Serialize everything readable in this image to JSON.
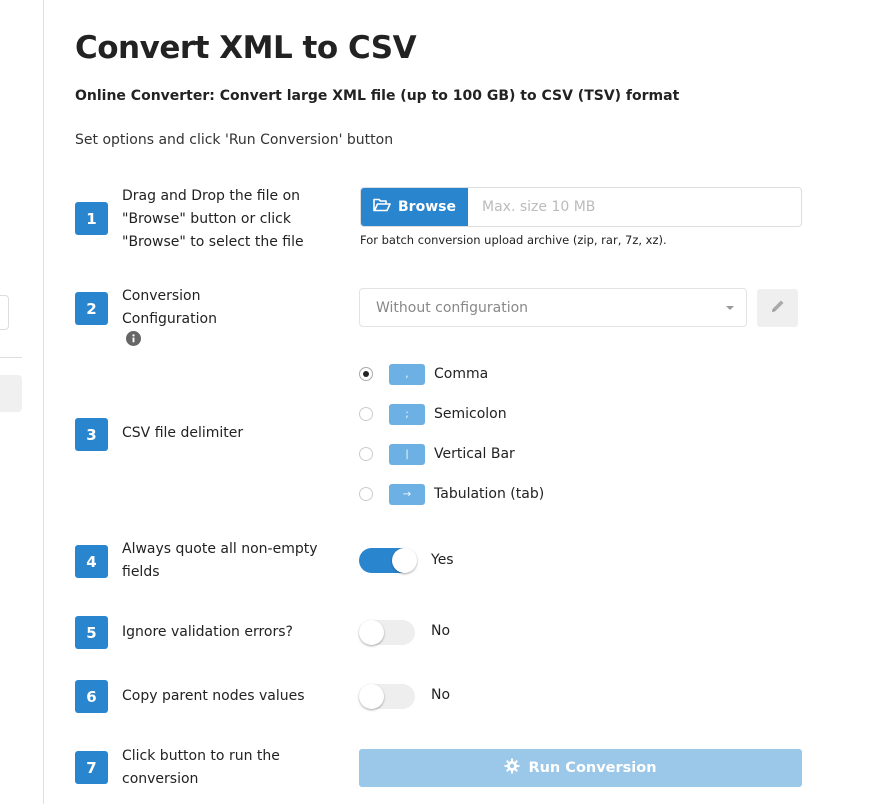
{
  "header": {
    "title": "Convert XML to CSV",
    "subtitle": "Online Converter: Convert large XML file (up to 100 GB) to CSV (TSV) format",
    "instructions": "Set options and click 'Run Conversion' button"
  },
  "steps": [
    {
      "number": "1",
      "label": "Drag and Drop the file on \"Browse\" button or click \"Browse\" to select the file"
    },
    {
      "number": "2",
      "label": "Conversion Configuration"
    },
    {
      "number": "3",
      "label": "CSV file delimiter"
    },
    {
      "number": "4",
      "label": "Always quote all non-empty fields"
    },
    {
      "number": "5",
      "label": "Ignore validation errors?"
    },
    {
      "number": "6",
      "label": "Copy parent nodes values"
    },
    {
      "number": "7",
      "label": "Click button to run the conversion"
    }
  ],
  "upload": {
    "browse_label": "Browse",
    "placeholder": "Max. size 10 MB",
    "help": "For batch conversion upload archive (zip, rar, 7z, xz)."
  },
  "configuration": {
    "selected": "Without configuration",
    "info_icon": "info-circle-icon",
    "edit_icon": "pencil-icon"
  },
  "delimiters": [
    {
      "symbol": ",",
      "label": "Comma",
      "selected": true
    },
    {
      "symbol": ";",
      "label": "Semicolon",
      "selected": false
    },
    {
      "symbol": "|",
      "label": "Vertical Bar",
      "selected": false
    },
    {
      "symbol": "→",
      "label": "Tabulation (tab)",
      "selected": false
    }
  ],
  "toggles": {
    "quote_all": {
      "on": true,
      "label": "Yes"
    },
    "ignore_errors": {
      "on": false,
      "label": "No"
    },
    "copy_parent": {
      "on": false,
      "label": "No"
    }
  },
  "run": {
    "label": "Run Conversion",
    "icon": "gear-icon"
  },
  "colors": {
    "accent": "#2a85cf",
    "run_disabled": "#9bc7e8",
    "delimiter_badge": "#6cb0e4"
  }
}
